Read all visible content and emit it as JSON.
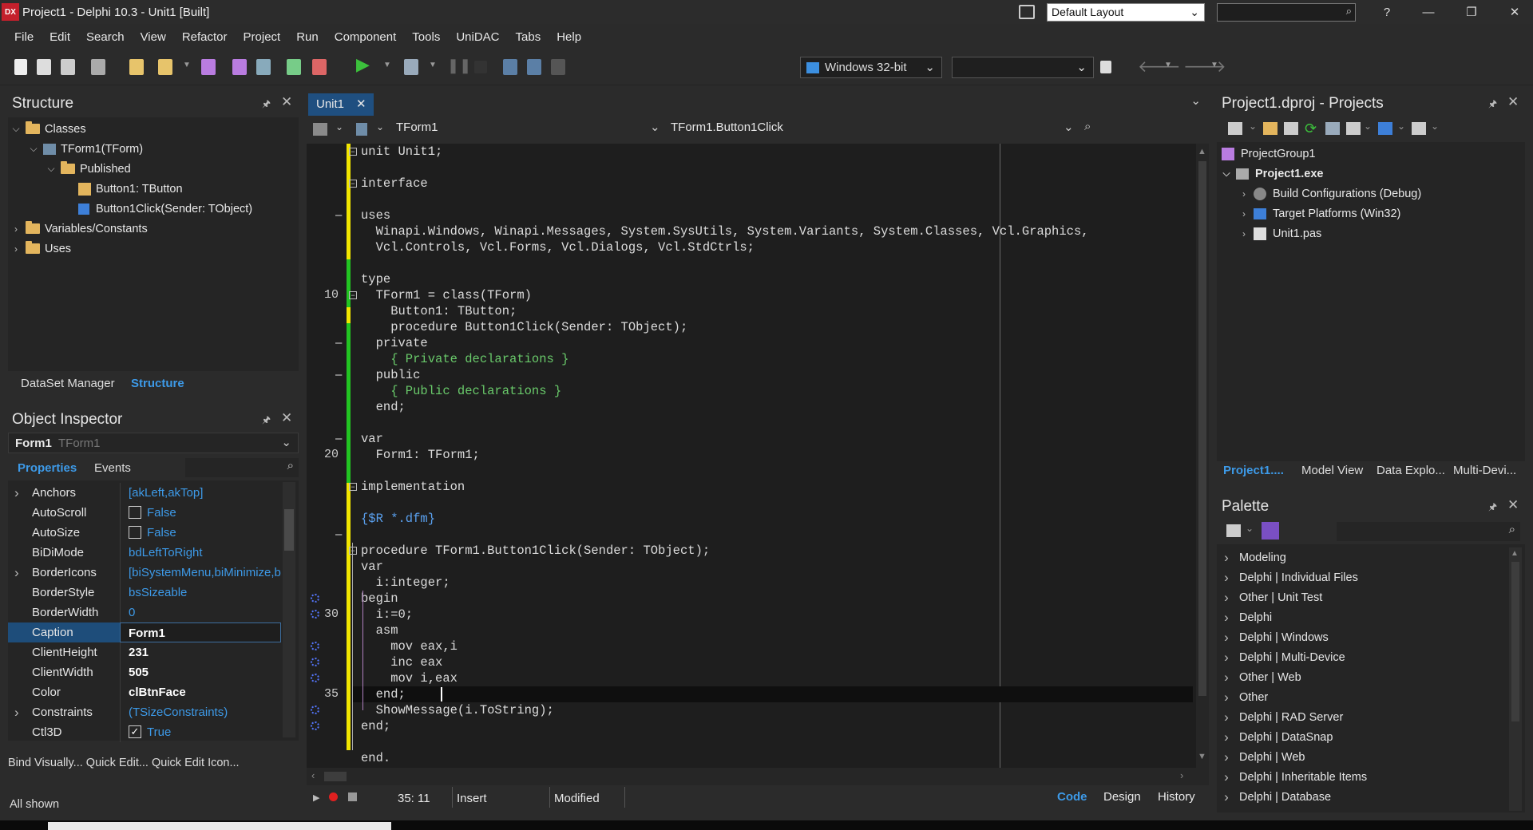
{
  "title": {
    "logo": "DX",
    "text": "Project1 - Delphi 10.3 - Unit1 [Built]",
    "layout": "Default Layout",
    "help": "?"
  },
  "menu": [
    "File",
    "Edit",
    "Search",
    "View",
    "Refactor",
    "Project",
    "Run",
    "Component",
    "Tools",
    "UniDAC",
    "Tabs",
    "Help"
  ],
  "toolbar": {
    "platform": "Windows 32-bit",
    "config": ""
  },
  "structure": {
    "title": "Structure",
    "tree": [
      {
        "label": "Classes",
        "level": 0,
        "icon": "folder",
        "expanded": true
      },
      {
        "label": "TForm1(TForm)",
        "level": 1,
        "icon": "class",
        "expanded": true
      },
      {
        "label": "Published",
        "level": 2,
        "icon": "folder",
        "expanded": true
      },
      {
        "label": "Button1: TButton",
        "level": 3,
        "icon": "field"
      },
      {
        "label": "Button1Click(Sender: TObject)",
        "level": 3,
        "icon": "method"
      },
      {
        "label": "Variables/Constants",
        "level": 0,
        "icon": "folder",
        "expanded": false
      },
      {
        "label": "Uses",
        "level": 0,
        "icon": "folder",
        "expanded": false
      }
    ],
    "tabs": [
      "DataSet Manager",
      "Structure"
    ]
  },
  "inspector": {
    "title": "Object Inspector",
    "object_name": "Form1",
    "object_type": "TForm1",
    "tabs": [
      "Properties",
      "Events"
    ],
    "rows": [
      {
        "name": "Anchors",
        "value": "[akLeft,akTop]",
        "expand": true
      },
      {
        "name": "AutoScroll",
        "value": "False",
        "check": false
      },
      {
        "name": "AutoSize",
        "value": "False",
        "check": false
      },
      {
        "name": "BiDiMode",
        "value": "bdLeftToRight"
      },
      {
        "name": "BorderIcons",
        "value": "[biSystemMenu,biMinimize,b",
        "expand": true
      },
      {
        "name": "BorderStyle",
        "value": "bsSizeable"
      },
      {
        "name": "BorderWidth",
        "value": "0"
      },
      {
        "name": "Caption",
        "value": "Form1",
        "selected": true,
        "bold": true
      },
      {
        "name": "ClientHeight",
        "value": "231",
        "bold": true
      },
      {
        "name": "ClientWidth",
        "value": "505",
        "bold": true
      },
      {
        "name": "Color",
        "value": "clBtnFace",
        "bold": true
      },
      {
        "name": "Constraints",
        "value": "(TSizeConstraints)",
        "expand": true
      },
      {
        "name": "Ctl3D",
        "value": "True",
        "check": true
      }
    ],
    "footer_links": "Bind Visually... Quick Edit... Quick Edit Icon...",
    "status": "All shown"
  },
  "editor": {
    "tab": "Unit1",
    "class_combo": "TForm1",
    "method_combo": "TForm1.Button1Click",
    "lines": [
      {
        "n": "",
        "t": "unit Unit1;"
      },
      {
        "n": "",
        "t": ""
      },
      {
        "n": "",
        "t": "interface"
      },
      {
        "n": "",
        "t": ""
      },
      {
        "n": "",
        "t": "uses"
      },
      {
        "n": "",
        "t": "  Winapi.Windows, Winapi.Messages, System.SysUtils, System.Variants, System.Classes, Vcl.Graphics,"
      },
      {
        "n": "",
        "t": "  Vcl.Controls, Vcl.Forms, Vcl.Dialogs, Vcl.StdCtrls;"
      },
      {
        "n": "",
        "t": ""
      },
      {
        "n": "",
        "t": "type"
      },
      {
        "n": "10",
        "t": "  TForm1 = class(TForm)"
      },
      {
        "n": "",
        "t": "    Button1: TButton;"
      },
      {
        "n": "",
        "t": "    procedure Button1Click(Sender: TObject);"
      },
      {
        "n": "",
        "t": "  private"
      },
      {
        "n": "",
        "t": "    { Private declarations }",
        "c": "cm"
      },
      {
        "n": "",
        "t": "  public"
      },
      {
        "n": "",
        "t": "    { Public declarations }",
        "c": "cm"
      },
      {
        "n": "",
        "t": "  end;"
      },
      {
        "n": "",
        "t": ""
      },
      {
        "n": "",
        "t": "var"
      },
      {
        "n": "20",
        "t": "  Form1: TForm1;"
      },
      {
        "n": "",
        "t": ""
      },
      {
        "n": "",
        "t": "implementation"
      },
      {
        "n": "",
        "t": ""
      },
      {
        "n": "",
        "t": "{$R *.dfm}",
        "c": "dir"
      },
      {
        "n": "",
        "t": ""
      },
      {
        "n": "",
        "t": "procedure TForm1.Button1Click(Sender: TObject);"
      },
      {
        "n": "",
        "t": "var"
      },
      {
        "n": "",
        "t": "  i:integer;"
      },
      {
        "n": "",
        "t": "begin"
      },
      {
        "n": "30",
        "t": "  i:=0;"
      },
      {
        "n": "",
        "t": "  asm"
      },
      {
        "n": "",
        "t": "    mov eax,i"
      },
      {
        "n": "",
        "t": "    inc eax"
      },
      {
        "n": "",
        "t": "    mov i,eax"
      },
      {
        "n": "35",
        "t": "  end;"
      },
      {
        "n": "",
        "t": "  ShowMessage(i.ToString);"
      },
      {
        "n": "",
        "t": "end;"
      },
      {
        "n": "",
        "t": ""
      },
      {
        "n": "",
        "t": "end."
      }
    ],
    "status": {
      "position": "35: 11",
      "mode": "Insert",
      "modified": "Modified"
    },
    "view_tabs": [
      "Code",
      "Design",
      "History"
    ]
  },
  "projects": {
    "title": "Project1.dproj - Projects",
    "tree": [
      {
        "label": "ProjectGroup1",
        "level": 0
      },
      {
        "label": "Project1.exe",
        "level": 0,
        "bold": true,
        "expanded": true
      },
      {
        "label": "Build Configurations (Debug)",
        "level": 1
      },
      {
        "label": "Target Platforms (Win32)",
        "level": 1
      },
      {
        "label": "Unit1.pas",
        "level": 1
      }
    ],
    "tabs": [
      "Project1....",
      "Model View",
      "Data Explo...",
      "Multi-Devi..."
    ]
  },
  "palette": {
    "title": "Palette",
    "items": [
      "Modeling",
      "Delphi | Individual Files",
      "Other | Unit Test",
      "Delphi",
      "Delphi | Windows",
      "Delphi | Multi-Device",
      "Other | Web",
      "Other",
      "Delphi | RAD Server",
      "Delphi | DataSnap",
      "Delphi | Web",
      "Delphi | Inheritable Items",
      "Delphi | Database"
    ]
  },
  "colors": {
    "accent": "#3d9ae8",
    "selection": "#1e4d7a",
    "title": "#2c2c2c",
    "editor_bg": "#1e1e1e",
    "change_bar_green": "#22c422",
    "change_bar_yellow": "#f2e600"
  }
}
